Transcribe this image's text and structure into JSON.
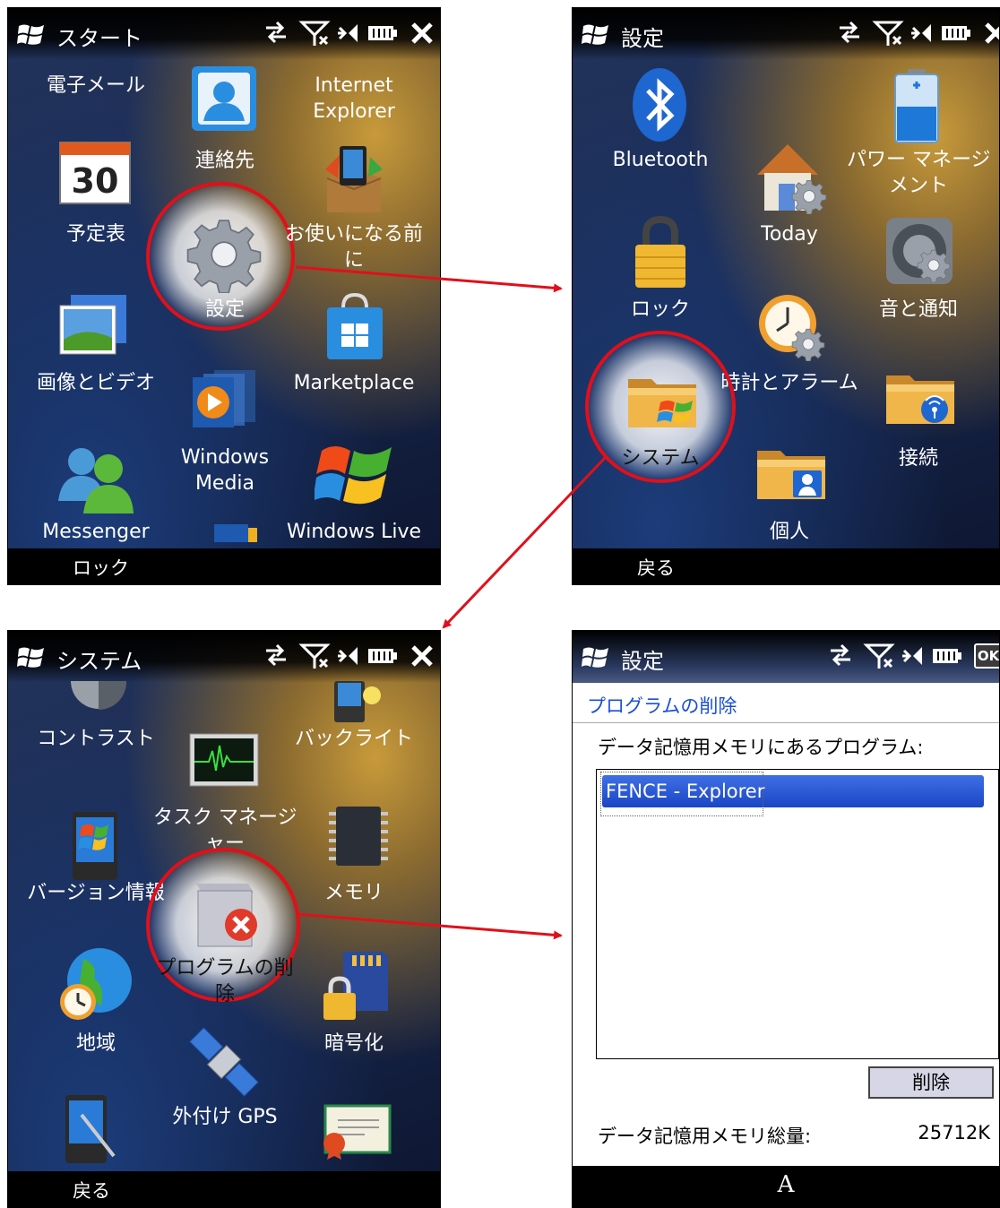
{
  "screen1": {
    "title": "スタート",
    "items": {
      "email": "電子メール",
      "contacts": "連絡先",
      "ie": "Internet\nExplorer",
      "calendar": "予定表",
      "calendar_day": "30",
      "settings": "設定",
      "getting_started": "お使いになる前\nに",
      "pictures": "画像とビデオ",
      "marketplace": "Marketplace",
      "media": "Windows\nMedia",
      "messenger": "Messenger",
      "windows_live": "Windows Live"
    },
    "softkey": "ロック"
  },
  "screen2": {
    "title": "設定",
    "items": {
      "bluetooth": "Bluetooth",
      "power": "パワー マネージ\nメント",
      "today": "Today",
      "lock": "ロック",
      "sounds": "音と通知",
      "clock": "時計とアラーム",
      "system": "システム",
      "connections": "接続",
      "personal": "個人"
    },
    "softkey": "戻る"
  },
  "screen3": {
    "title": "システム",
    "items": {
      "contrast": "コントラスト",
      "backlight": "バックライト",
      "task_manager": "タスク マネージ\nャー",
      "version": "バージョン情報",
      "memory": "メモリ",
      "remove_programs": "プログラムの削\n除",
      "region": "地域",
      "encryption": "暗号化",
      "external_gps": "外付け GPS"
    },
    "softkey": "戻る"
  },
  "screen4": {
    "title": "設定",
    "ok_label": "OK",
    "link": "プログラムの削除",
    "list_label": "データ記憶用メモリにあるプログラム:",
    "programs": [
      "FENCE - Explorer"
    ],
    "remove_button": "削除",
    "total_label": "データ記憶用メモリ総量:",
    "total_value": "25712K",
    "caption": "A"
  },
  "colors": {
    "highlight": "#e0101a",
    "selection": "#2350d0",
    "link": "#1c4fd8"
  }
}
